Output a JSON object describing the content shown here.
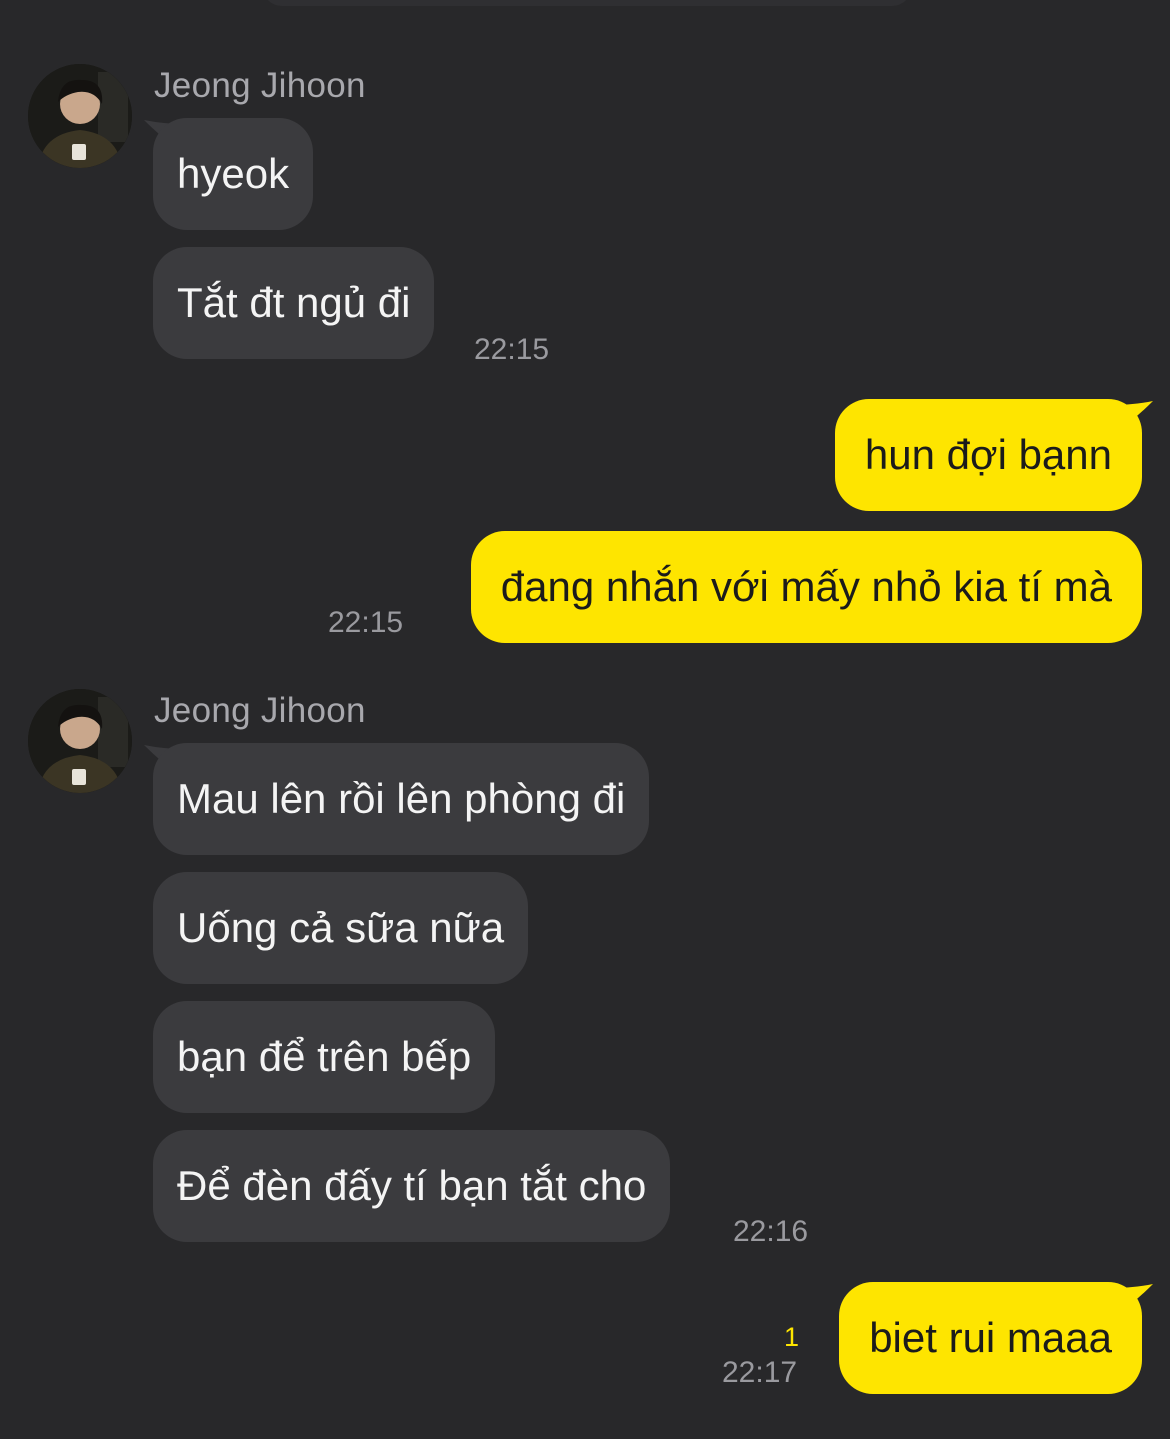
{
  "colors": {
    "background": "#28282a",
    "incoming_bubble": "#3b3b3e",
    "outgoing_bubble": "#fee500",
    "unread_indicator": "#fee500"
  },
  "groups": [
    {
      "sender": "Jeong Jihoon",
      "avatar_icon": "profile-photo-avatar",
      "messages": [
        "hyeok",
        "Tắt đt ngủ đi"
      ],
      "time": "22:15"
    },
    {
      "sender": "me",
      "messages": [
        "hun đợi bạnn",
        "đang nhắn với mấy nhỏ kia tí mà"
      ],
      "time": "22:15"
    },
    {
      "sender": "Jeong Jihoon",
      "avatar_icon": "profile-photo-avatar",
      "messages": [
        "Mau lên rồi lên phòng đi",
        "Uống cả sữa nữa",
        "bạn để trên bếp",
        "Để đèn đấy tí bạn tắt cho"
      ],
      "time": "22:16"
    },
    {
      "sender": "me",
      "messages": [
        "biet rui maaa"
      ],
      "time": "22:17",
      "unread_count": "1"
    }
  ]
}
